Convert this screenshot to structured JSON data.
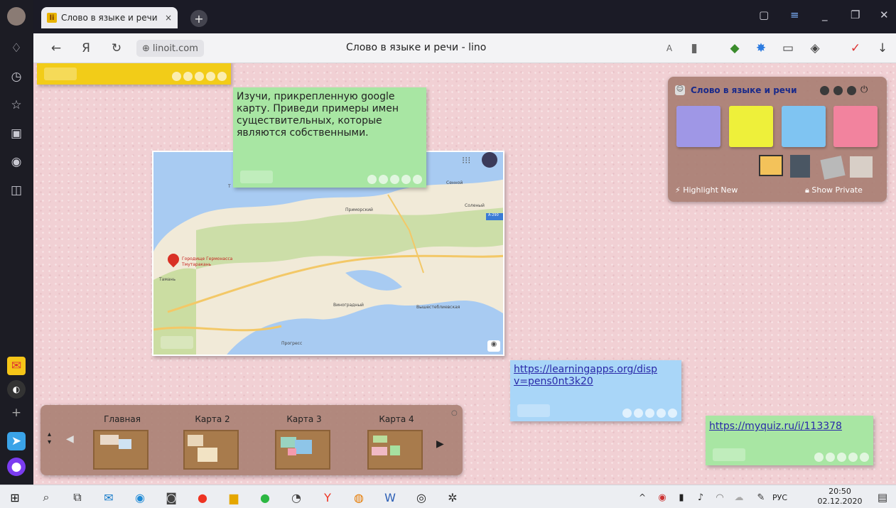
{
  "tab": {
    "favicon": "li",
    "title": "Слово в языке и речи",
    "close": "×"
  },
  "newtab": "+",
  "address": {
    "domain": "linoit.com",
    "page_title": "Слово в языке и речи - lino"
  },
  "notes": {
    "green_main": "Изучи, прикрепленную google карту. Приведи примеры имен существительных, которые являются собственными.",
    "blue_link": "https://learningapps.org/display?v=pens0nt3k20",
    "blue_link_line1": "https://learningapps.org/disp",
    "blue_link_line2": "v=pens0nt3k20",
    "green_link": "https://myquiz.ru/i/113378"
  },
  "map": {
    "places": [
      "Сенной",
      "Приморский",
      "Соленый",
      "Городище Гермонасса Тмутаракань",
      "Тамань",
      "Виноградный",
      "Вышестеблиевская",
      "Прогресс",
      "Т"
    ],
    "road": "А-290"
  },
  "palette": {
    "title": "Слово в языке и речи",
    "highlight_new": "Highlight New",
    "show_private": "Show Private",
    "colors": {
      "purple": "#9f97e6",
      "yellow": "#eef03a",
      "blue": "#7fc4f2",
      "pink": "#f2839e"
    }
  },
  "canvases": {
    "items": [
      "Главная",
      "Карта 2",
      "Карта 3",
      "Карта 4"
    ]
  },
  "taskbar": {
    "lang": "РУС",
    "time": "20:50",
    "date": "02.12.2020"
  }
}
